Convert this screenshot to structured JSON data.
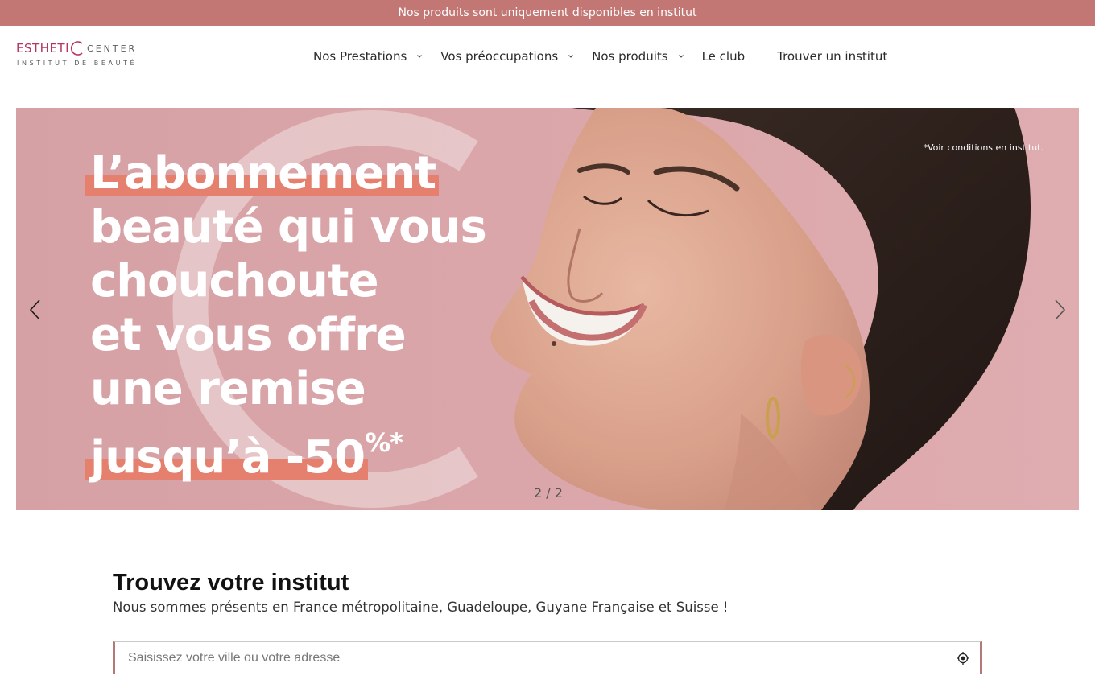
{
  "topbar": {
    "text": "Nos produits sont uniquement disponibles en institut"
  },
  "logo": {
    "part1": "ESTHETI",
    "part2": "CENTER",
    "tagline": "INSTITUT DE BEAUTÉ"
  },
  "nav": {
    "items": [
      {
        "label": "Nos Prestations",
        "has_dropdown": true
      },
      {
        "label": "Vos préoccupations",
        "has_dropdown": true
      },
      {
        "label": "Nos produits",
        "has_dropdown": true
      },
      {
        "label": "Le club",
        "has_dropdown": false
      },
      {
        "label": "Trouver un institut",
        "has_dropdown": false
      }
    ]
  },
  "hero": {
    "headline": {
      "line1": "L’abonnement",
      "line2": "beauté qui vous",
      "line3": "chouchoute",
      "line4": "et vous offre",
      "line5": "une remise",
      "line6": "jusqu’à -50",
      "line6_sup": "%*"
    },
    "conditions": "*Voir conditions en institut.",
    "counter": "2 / 2",
    "prev_icon": "chevron-left-icon",
    "next_icon": "chevron-right-icon",
    "colors": {
      "background": "#d9a3a6",
      "highlight": "#e5806e"
    }
  },
  "finder": {
    "title": "Trouvez votre institut",
    "subtitle": "Nous sommes présents en France métropolitaine, Guadeloupe, Guyane Française et Suisse !",
    "search_placeholder": "Saisissez votre ville ou votre adresse",
    "locate_icon": "geolocate-icon"
  },
  "colors": {
    "topbar": "#c27774",
    "brand": "#b4355e",
    "search_border": "#b47976"
  }
}
